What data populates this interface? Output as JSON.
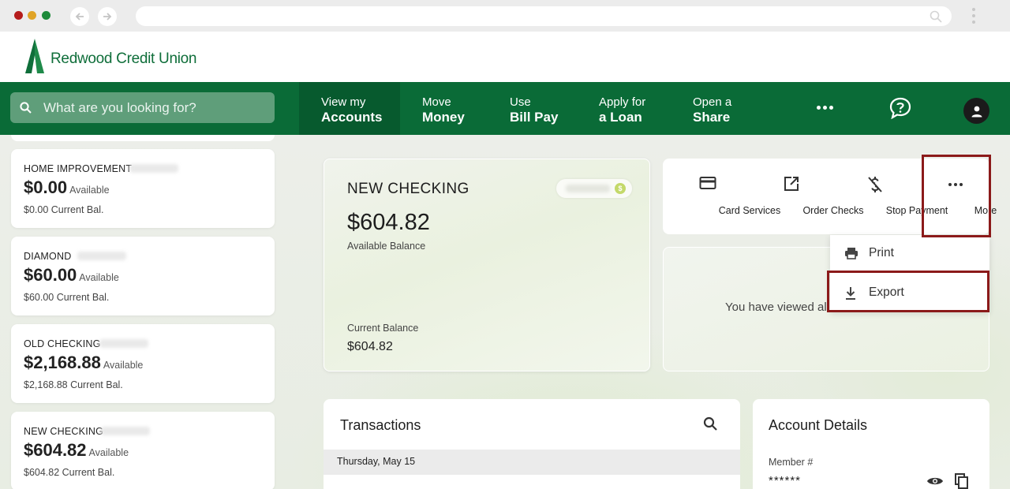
{
  "browser": {
    "traffic_colors": [
      "#b51c1c",
      "#e0a326",
      "#1d8a3a"
    ]
  },
  "header": {
    "logo_text": "Redwood Credit Union",
    "brand_color": "#0a6b37"
  },
  "topnav": {
    "search_placeholder": "What are you looking for?",
    "items": [
      {
        "line1": "View my",
        "line2": "Accounts",
        "active": true
      },
      {
        "line1": "Move",
        "line2": "Money",
        "active": false
      },
      {
        "line1": "Use",
        "line2": "Bill Pay",
        "active": false
      },
      {
        "line1": "Apply for",
        "line2": "a Loan",
        "active": false
      },
      {
        "line1": "Open a",
        "line2": "Share",
        "active": false
      }
    ]
  },
  "accounts": [
    {
      "name": "HOME IMPROVEMENT",
      "amount": "$0.00",
      "available_label": "Available",
      "current": "$0.00 Current Bal."
    },
    {
      "name": "DIAMOND",
      "amount": "$60.00",
      "available_label": "Available",
      "current": "$60.00 Current Bal."
    },
    {
      "name": "OLD CHECKING",
      "amount": "$2,168.88",
      "available_label": "Available",
      "current": "$2,168.88 Current Bal."
    },
    {
      "name": "NEW CHECKING",
      "amount": "$604.82",
      "available_label": "Available",
      "current": "$604.82 Current Bal."
    }
  ],
  "selected_account": {
    "title": "NEW CHECKING",
    "badge_symbol": "$",
    "available_amount": "$604.82",
    "available_label": "Available Balance",
    "current_label": "Current Balance",
    "current_amount": "$604.82"
  },
  "actions": [
    {
      "label": "Card Services",
      "icon": "credit-card-icon"
    },
    {
      "label": "Order Checks",
      "icon": "external-link-icon"
    },
    {
      "label": "Stop Payment",
      "icon": "no-dollar-icon"
    },
    {
      "label": "More",
      "icon": "more-horizontal-icon"
    }
  ],
  "more_menu": [
    {
      "label": "Print",
      "icon": "print-icon"
    },
    {
      "label": "Export",
      "icon": "download-icon"
    }
  ],
  "viewed_message": "You have viewed al",
  "transactions": {
    "title": "Transactions",
    "date_header": "Thursday, May 15"
  },
  "account_details": {
    "title": "Account Details",
    "member_label": "Member #",
    "member_value": "******"
  },
  "highlight_color": "#8b1a1a"
}
